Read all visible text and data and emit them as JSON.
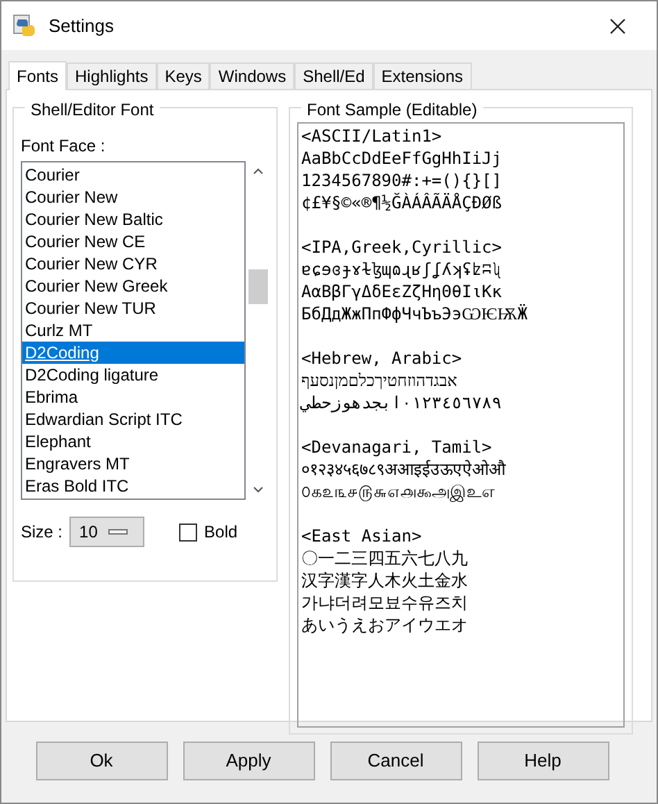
{
  "window": {
    "title": "Settings"
  },
  "tabs": [
    {
      "label": "Fonts",
      "selected": true
    },
    {
      "label": "Highlights",
      "selected": false
    },
    {
      "label": "Keys",
      "selected": false
    },
    {
      "label": "Windows",
      "selected": false
    },
    {
      "label": "Shell/Ed",
      "selected": false
    },
    {
      "label": "Extensions",
      "selected": false
    }
  ],
  "font_panel": {
    "title": "Shell/Editor Font",
    "font_face_label": "Font Face :",
    "fonts": [
      {
        "label": "Courier",
        "selected": false
      },
      {
        "label": "Courier New",
        "selected": false
      },
      {
        "label": "Courier New Baltic",
        "selected": false
      },
      {
        "label": "Courier New CE",
        "selected": false
      },
      {
        "label": "Courier New CYR",
        "selected": false
      },
      {
        "label": "Courier New Greek",
        "selected": false
      },
      {
        "label": "Courier New TUR",
        "selected": false
      },
      {
        "label": "Curlz MT",
        "selected": false
      },
      {
        "label": "D2Coding",
        "selected": true
      },
      {
        "label": "D2Coding ligature",
        "selected": false
      },
      {
        "label": "Ebrima",
        "selected": false
      },
      {
        "label": "Edwardian Script ITC",
        "selected": false
      },
      {
        "label": "Elephant",
        "selected": false
      },
      {
        "label": "Engravers MT",
        "selected": false
      },
      {
        "label": "Eras Bold ITC",
        "selected": false
      }
    ],
    "size_label": "Size :",
    "size_value": "10",
    "bold": {
      "label": "Bold",
      "checked": false
    }
  },
  "sample": {
    "title": "Font Sample (Editable)",
    "sections": [
      {
        "lines": [
          "<ASCII/Latin1>",
          "AaBbCcDdEeFfGgHhIiJj",
          "1234567890#:+=(){}[]",
          "¢£¥§©«®¶½ĞÀÁÂÃÄÅÇÐØß"
        ]
      },
      {
        "lines": [
          "<IPA,Greek,Cyrillic>",
          "ɐɕɘɞɟɤɫɮɰɷɻʁʃʆʎʞʢʫʭʯ",
          "ΑαΒβΓγΔδΕεΖζΗηΘθΙιΚκ",
          "БбДдЖжПпФфЧчЪъЭэѠѤѬӜ"
        ]
      },
      {
        "lines": [
          "<Hebrew, Arabic>",
          "אבגדהוזחטיךכלםמןנסעף",
          "٠١٢٣٤٥٦٧٨٩ابجدهوزحطي"
        ]
      },
      {
        "lines": [
          "<Devanagari, Tamil>",
          "०१२३४५६७८९अआइईउऊएऐओऔ",
          "௦௧௨௩௪௫௬௭௮௯அஇஉஎ"
        ]
      },
      {
        "lines": [
          "<East Asian>",
          "〇一二三四五六七八九",
          "汉字漢字人木火土金水",
          "가냐더려모뵤수유즈치",
          "あいうえおアイウエオ"
        ]
      }
    ]
  },
  "buttons": [
    "Ok",
    "Apply",
    "Cancel",
    "Help"
  ]
}
